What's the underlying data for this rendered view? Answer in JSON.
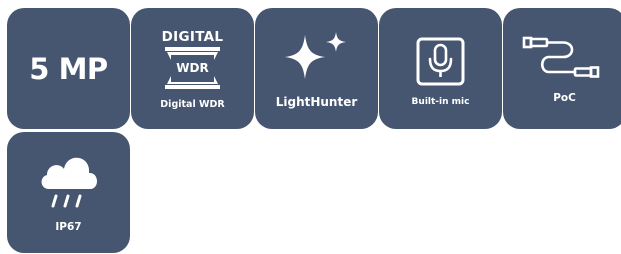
{
  "features": [
    {
      "id": "resolution",
      "big_text": "5 MP",
      "icon": "resolution-text"
    },
    {
      "id": "digital-wdr",
      "badge_top": "DIGITAL",
      "badge_mid": "WDR",
      "label": "Digital WDR",
      "icon": "wdr-hourglass-icon"
    },
    {
      "id": "lighthunter",
      "label": "LightHunter",
      "icon": "sparkle-icon"
    },
    {
      "id": "mic",
      "label": "Built-in mic",
      "icon": "microphone-icon"
    },
    {
      "id": "poe",
      "label": "PoC",
      "icon": "cable-icon"
    },
    {
      "id": "ip67",
      "label": "IP67",
      "icon": "rain-cloud-icon"
    }
  ],
  "colors": {
    "tile_background": "#465670",
    "foreground": "#ffffff"
  }
}
